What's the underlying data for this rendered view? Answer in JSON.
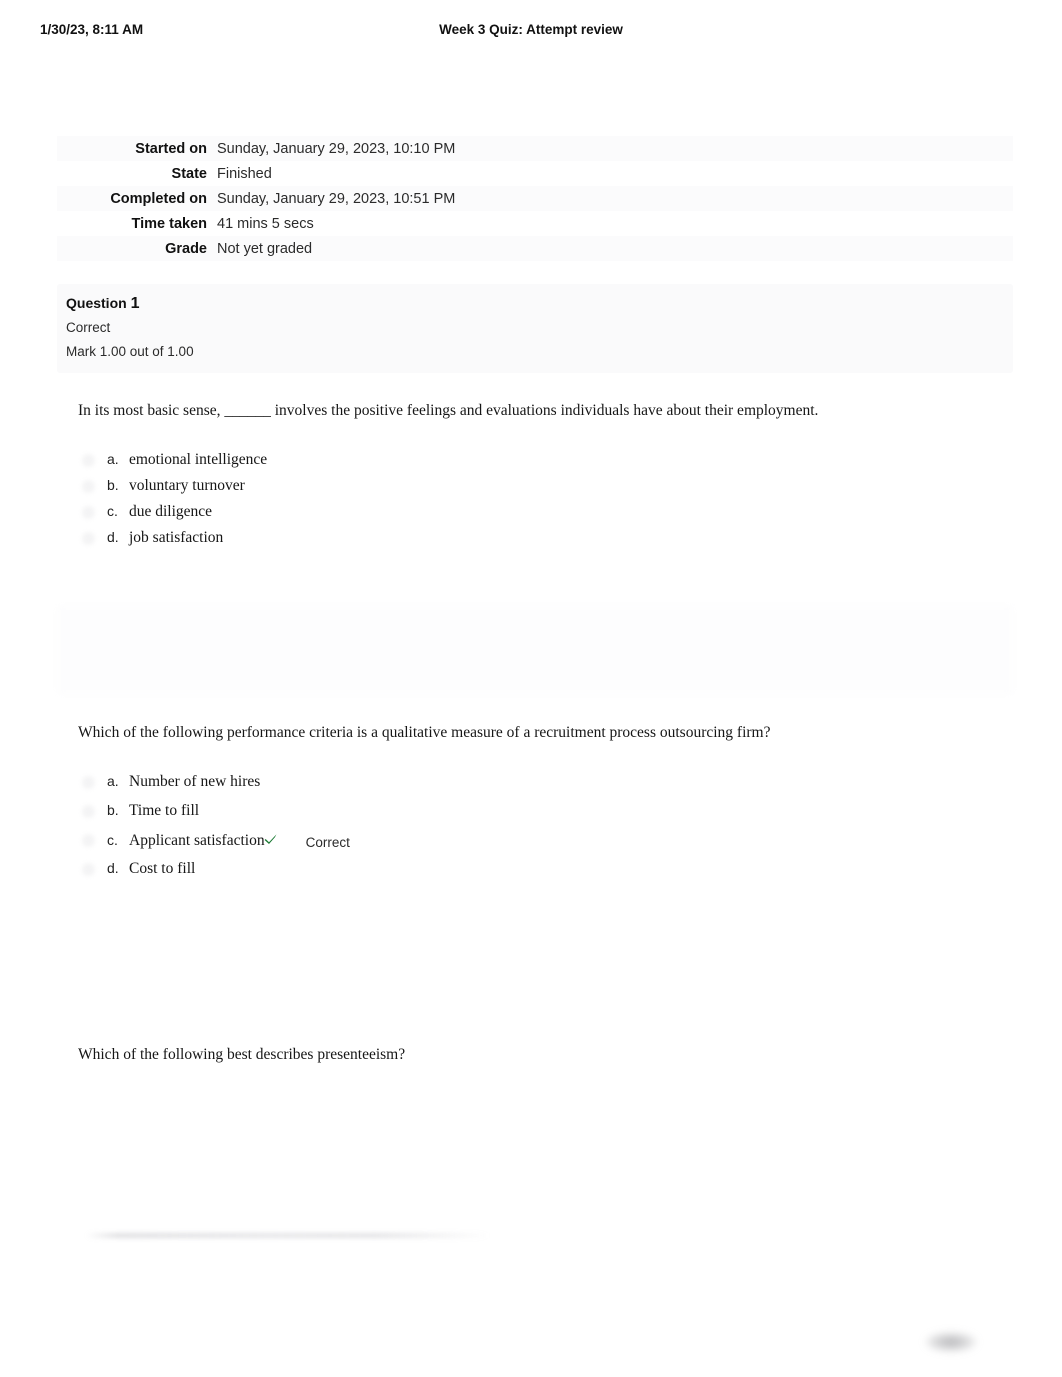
{
  "print_header": {
    "date": "1/30/23, 8:11 AM",
    "title": "Week 3 Quiz: Attempt review"
  },
  "summary": {
    "rows": [
      {
        "label": "Started on",
        "value": "Sunday, January 29, 2023, 10:10 PM"
      },
      {
        "label": "State",
        "value": "Finished"
      },
      {
        "label": "Completed on",
        "value": "Sunday, January 29, 2023, 10:51 PM"
      },
      {
        "label": "Time taken",
        "value": "41 mins 5 secs"
      },
      {
        "label": "Grade",
        "value": "Not yet graded"
      }
    ]
  },
  "questions": [
    {
      "header": {
        "question_label": "Question",
        "number": "1",
        "state": "Correct",
        "mark": "Mark 1.00 out of 1.00"
      },
      "stem": "In its most basic sense, ______ involves the positive feelings and evaluations individuals have about their employment.",
      "options": [
        {
          "letter": "a.",
          "text": "emotional intelligence",
          "correct_mark": "",
          "feedback": ""
        },
        {
          "letter": "b.",
          "text": "voluntary turnover",
          "correct_mark": "",
          "feedback": ""
        },
        {
          "letter": "c.",
          "text": "due diligence",
          "correct_mark": "",
          "feedback": ""
        },
        {
          "letter": "d.",
          "text": "job satisfaction",
          "correct_mark": "",
          "feedback": ""
        }
      ]
    },
    {
      "header": {
        "question_label": "",
        "number": "",
        "state": "",
        "mark": ""
      },
      "stem": "Which of the following performance criteria is a qualitative measure of a recruitment process outsourcing firm?",
      "options": [
        {
          "letter": "a.",
          "text": "Number of new hires",
          "correct_mark": "",
          "feedback": ""
        },
        {
          "letter": "b.",
          "text": "Time to fill",
          "correct_mark": "",
          "feedback": ""
        },
        {
          "letter": "c.",
          "text": "Applicant satisfaction",
          "correct_mark": "✔",
          "feedback": "Correct"
        },
        {
          "letter": "d.",
          "text": "Cost to fill",
          "correct_mark": "",
          "feedback": ""
        }
      ]
    },
    {
      "header": {
        "question_label": "",
        "number": "",
        "state": "",
        "mark": ""
      },
      "stem": "Which of the following best describes presenteeism?",
      "options": []
    }
  ],
  "colors": {
    "correct_check": "#1a7a33",
    "card_background": "#fafafb",
    "page_background": "#ffffff",
    "text": "#161616"
  },
  "footer": {
    "page_number": ""
  }
}
